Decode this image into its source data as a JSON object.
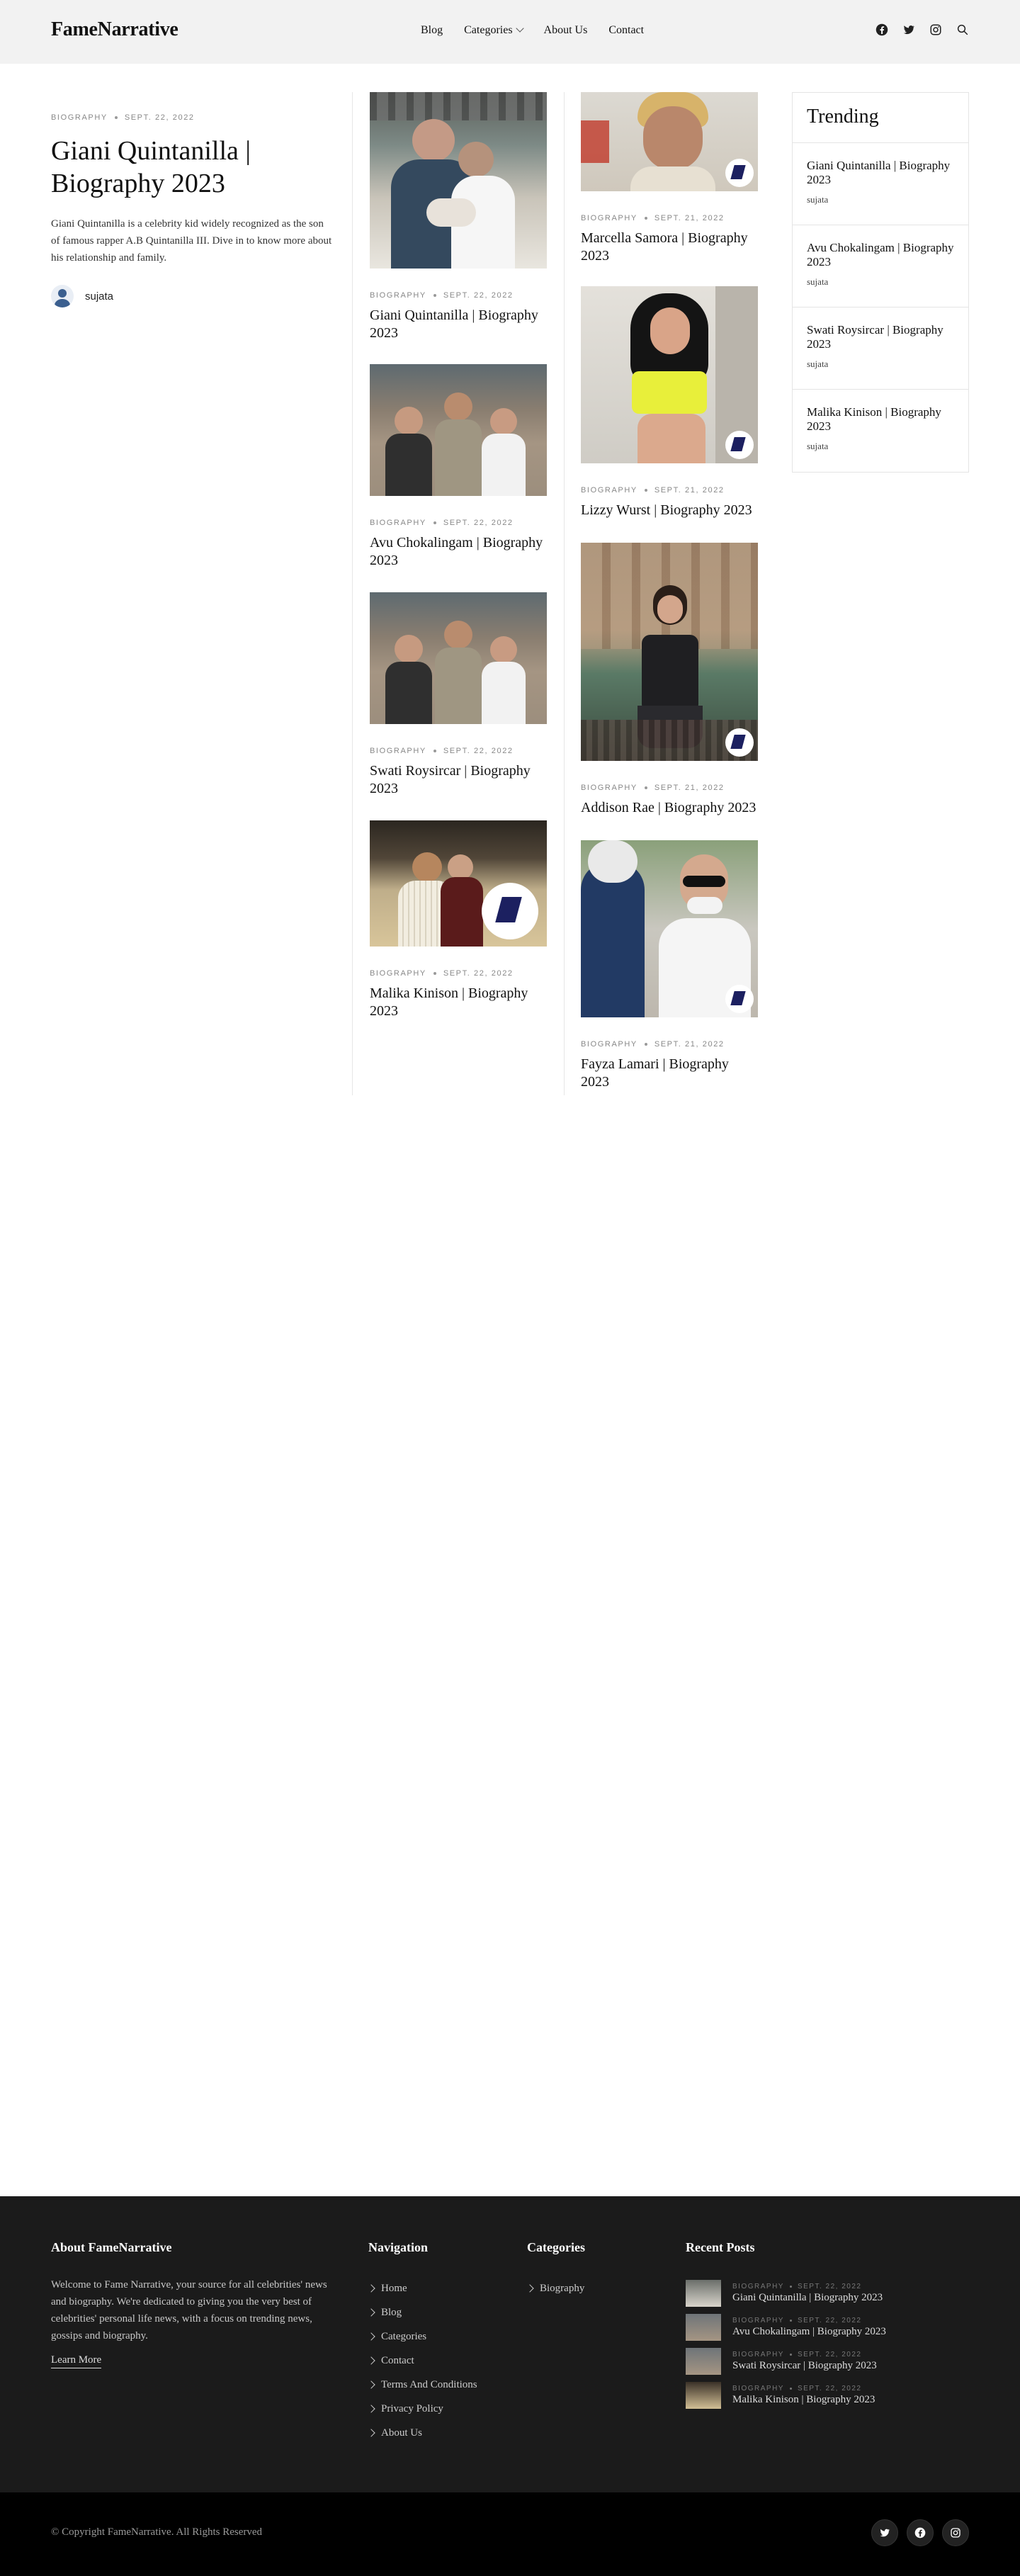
{
  "header": {
    "logo": "FameNarrative",
    "nav": [
      "Blog",
      "Categories",
      "About Us",
      "Contact"
    ]
  },
  "hero": {
    "category": "BIOGRAPHY",
    "date": "SEPT. 22, 2022",
    "title": "Giani Quintanilla | Biography 2023",
    "excerpt": "Giani Quintanilla is a celebrity kid widely recognized as the son of famous rapper A.B Quintanilla III. Dive in to know more about his relationship and family.",
    "author": "sujata"
  },
  "column2": [
    {
      "category": "BIOGRAPHY",
      "date": "SEPT. 22, 2022",
      "title": "Giani Quintanilla | Biography 2023"
    },
    {
      "category": "BIOGRAPHY",
      "date": "SEPT. 22, 2022",
      "title": "Avu Chokalingam | Biography 2023"
    },
    {
      "category": "BIOGRAPHY",
      "date": "SEPT. 22, 2022",
      "title": "Swati Roysircar | Biography 2023"
    },
    {
      "category": "BIOGRAPHY",
      "date": "SEPT. 22, 2022",
      "title": "Malika Kinison | Biography 2023"
    }
  ],
  "column3": [
    {
      "category": "BIOGRAPHY",
      "date": "SEPT. 21, 2022",
      "title": "Marcella Samora | Biography 2023"
    },
    {
      "category": "BIOGRAPHY",
      "date": "SEPT. 21, 2022",
      "title": "Lizzy Wurst | Biography 2023"
    },
    {
      "category": "BIOGRAPHY",
      "date": "SEPT. 21, 2022",
      "title": "Addison Rae | Biography 2023"
    },
    {
      "category": "BIOGRAPHY",
      "date": "SEPT. 21, 2022",
      "title": "Fayza Lamari | Biography 2023"
    }
  ],
  "trending": {
    "heading": "Trending",
    "items": [
      {
        "title": "Giani Quintanilla | Biography 2023",
        "author": "sujata"
      },
      {
        "title": "Avu Chokalingam | Biography 2023",
        "author": "sujata"
      },
      {
        "title": "Swati Roysircar | Biography 2023",
        "author": "sujata"
      },
      {
        "title": "Malika Kinison | Biography 2023",
        "author": "sujata"
      }
    ]
  },
  "footer": {
    "about_heading": "About FameNarrative",
    "about_text": "Welcome to Fame Narrative, your source for all celebrities' news and biography. We're dedicated to giving you the very best of celebrities' personal life news, with a focus on trending news, gossips and biography.",
    "learn_more": "Learn More",
    "nav_heading": "Navigation",
    "nav_items": [
      "Home",
      "Blog",
      "Categories",
      "Contact",
      "Terms And Conditions",
      "Privacy Policy",
      "About Us"
    ],
    "categories_heading": "Categories",
    "categories": [
      "Biography"
    ],
    "recent_heading": "Recent Posts",
    "recent": [
      {
        "category": "BIOGRAPHY",
        "date": "SEPT. 22, 2022",
        "title": "Giani Quintanilla | Biography 2023"
      },
      {
        "category": "BIOGRAPHY",
        "date": "SEPT. 22, 2022",
        "title": "Avu Chokalingam | Biography 2023"
      },
      {
        "category": "BIOGRAPHY",
        "date": "SEPT. 22, 2022",
        "title": "Swati Roysircar | Biography 2023"
      },
      {
        "category": "BIOGRAPHY",
        "date": "SEPT. 22, 2022",
        "title": "Malika Kinison | Biography 2023"
      }
    ],
    "copyright": "© Copyright FameNarrative. All Rights Reserved"
  },
  "icons": {
    "top_social": [
      "facebook-icon",
      "twitter-icon",
      "instagram-icon",
      "search-icon"
    ],
    "footer_social": [
      "twitter-icon",
      "facebook-icon",
      "instagram-icon"
    ]
  }
}
